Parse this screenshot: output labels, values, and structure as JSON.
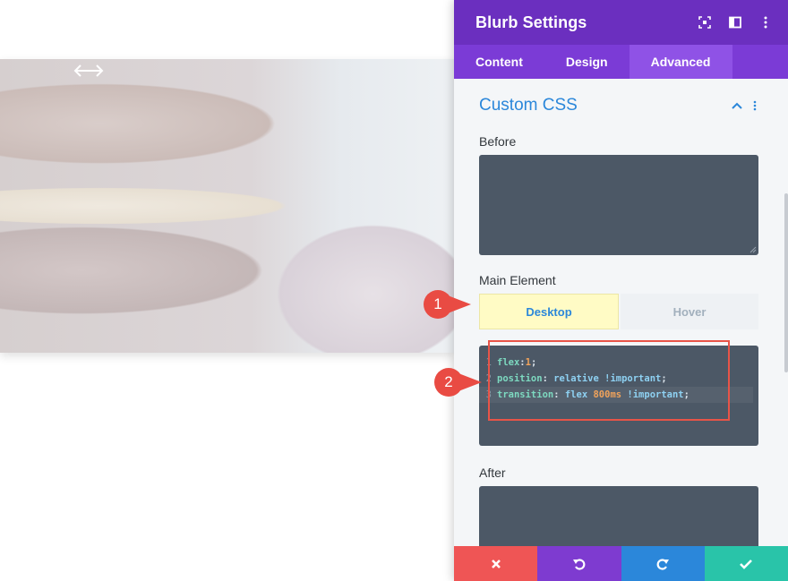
{
  "panel": {
    "title": "Blurb Settings",
    "tabs": [
      {
        "label": "Content",
        "active": false
      },
      {
        "label": "Design",
        "active": false
      },
      {
        "label": "Advanced",
        "active": true
      }
    ]
  },
  "section": {
    "title": "Custom CSS",
    "before_label": "Before",
    "main_label": "Main Element",
    "after_label": "After",
    "modes": {
      "desktop": "Desktop",
      "hover": "Hover"
    }
  },
  "code": {
    "lines": [
      {
        "n": "1",
        "prop": "flex",
        "sep": ":",
        "value": "",
        "num": "1",
        "end": ";"
      },
      {
        "n": "2",
        "prop": "position",
        "sep": ": ",
        "value": "relative !important",
        "num": "",
        "end": ";"
      },
      {
        "n": "3",
        "prop": "transition",
        "sep": ": ",
        "value": "flex ",
        "num": "800ms",
        "value2": " !important",
        "end": ";"
      }
    ]
  },
  "annotations": {
    "marker1": "1",
    "marker2": "2"
  },
  "icons": {
    "header": [
      "focus-icon",
      "split-view-icon",
      "more-vertical-icon"
    ],
    "section": [
      "chevron-up-icon",
      "more-vertical-icon"
    ],
    "footer": [
      "close-icon",
      "undo-icon",
      "redo-icon",
      "check-icon"
    ]
  },
  "colors": {
    "header": "#6b2fbf",
    "tabs": "#7b3bd6",
    "tab_active": "#8f52e6",
    "accent_blue": "#2b87da",
    "cancel": "#ef5555",
    "undo": "#7e3bd0",
    "redo": "#2b87da",
    "save": "#29c4a9",
    "annotation": "#e85448"
  }
}
